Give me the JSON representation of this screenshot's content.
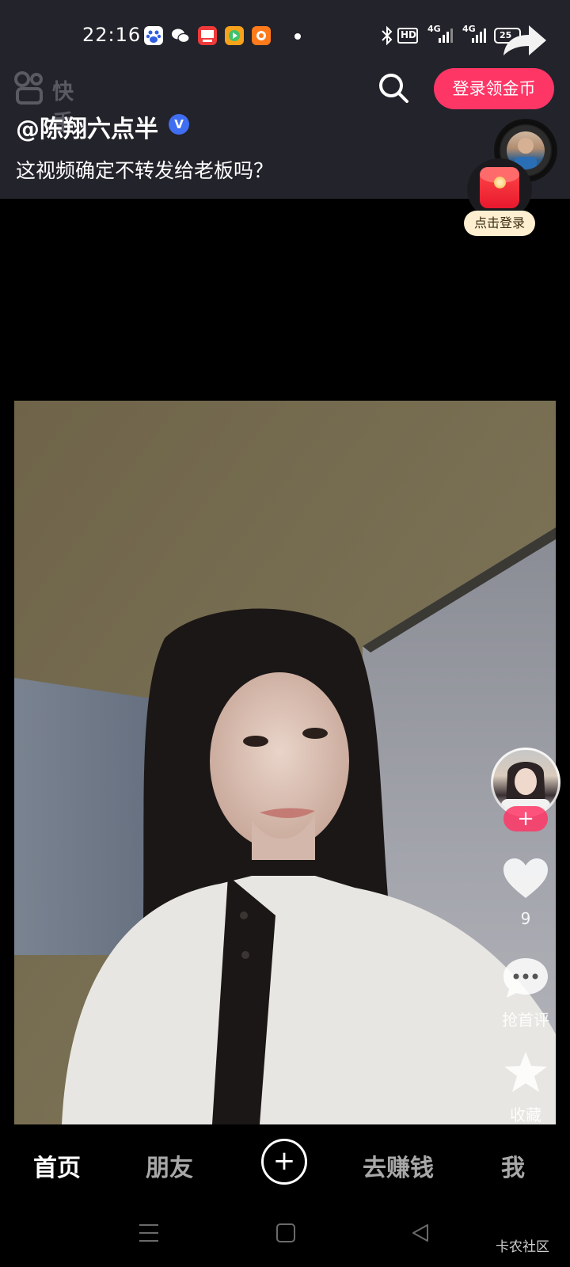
{
  "status_bar": {
    "time": "22:16",
    "notification_icons": [
      "baidu-icon",
      "wechat-icon",
      "toutiao-icon",
      "video-app-icon",
      "kuaishou-lite-icon"
    ],
    "right_icons": [
      "bluetooth-icon",
      "hd-icon",
      "signal-4g-icon",
      "signal-4g-icon",
      "battery-icon"
    ],
    "hd_text": "HD",
    "net1": "4G",
    "net2": "4G",
    "battery_level": "25"
  },
  "header": {
    "brand_name": "快手",
    "login_button_label": "登录领金币"
  },
  "video": {
    "author": "@陈翔六点半",
    "verified_mark": "V",
    "caption": "这视频确定不转发给老板吗？"
  },
  "redpack": {
    "label": "点击登录"
  },
  "actions": {
    "follow_symbol": "+",
    "like_count": "9",
    "comment_label": "抢首评",
    "favorite_label": "收藏"
  },
  "bottom_nav": {
    "items": [
      "首页",
      "朋友",
      "去赚钱",
      "我"
    ],
    "active_index": 0,
    "plus_symbol": "+"
  },
  "watermark": "卡农社区",
  "colors": {
    "accent": "#fe3666",
    "top_bar_bg": "#23232b",
    "verified_blue": "#3f6ef2"
  }
}
